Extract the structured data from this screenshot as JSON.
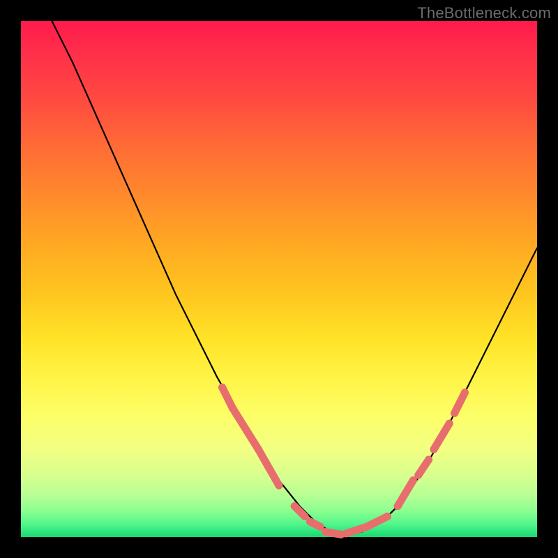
{
  "watermark": "TheBottleneck.com",
  "colors": {
    "frame": "#000000",
    "line": "#000000",
    "marker": "#e86d6d",
    "watermark": "#6b6b6b"
  },
  "chart_data": {
    "type": "line",
    "title": "",
    "xlabel": "",
    "ylabel": "",
    "xlim": [
      0,
      100
    ],
    "ylim": [
      0,
      100
    ],
    "grid": false,
    "legend": false,
    "series": [
      {
        "name": "bottleneck-curve",
        "x": [
          6,
          10,
          14,
          18,
          22,
          26,
          30,
          34,
          38,
          42,
          46,
          50,
          54,
          57,
          60,
          63,
          66,
          70,
          74,
          78,
          82,
          86,
          90,
          94,
          98,
          100
        ],
        "y": [
          100,
          92,
          83,
          74,
          65,
          56,
          47,
          39,
          31,
          24,
          17,
          11,
          6,
          3,
          1,
          0.5,
          1,
          3,
          7,
          13,
          20,
          28,
          36,
          44,
          52,
          56
        ]
      }
    ],
    "markers": [
      {
        "name": "left-cluster-1",
        "x_start": 39,
        "x_end": 41,
        "y_start": 29,
        "y_end": 25
      },
      {
        "name": "left-cluster-2",
        "x_start": 41,
        "x_end": 46,
        "y_start": 25,
        "y_end": 17
      },
      {
        "name": "left-cluster-3",
        "x_start": 46,
        "x_end": 50,
        "y_start": 17,
        "y_end": 10
      },
      {
        "name": "valley-1",
        "x_start": 53,
        "x_end": 55,
        "y_start": 6,
        "y_end": 4
      },
      {
        "name": "valley-2",
        "x_start": 56,
        "x_end": 58,
        "y_start": 3,
        "y_end": 2
      },
      {
        "name": "valley-3",
        "x_start": 59,
        "x_end": 62,
        "y_start": 1,
        "y_end": 0.5
      },
      {
        "name": "valley-4",
        "x_start": 63,
        "x_end": 67,
        "y_start": 0.7,
        "y_end": 2
      },
      {
        "name": "right-cluster-1",
        "x_start": 67,
        "x_end": 71,
        "y_start": 2,
        "y_end": 4
      },
      {
        "name": "right-cluster-2",
        "x_start": 73,
        "x_end": 76,
        "y_start": 6,
        "y_end": 11
      },
      {
        "name": "right-cluster-3",
        "x_start": 77,
        "x_end": 79,
        "y_start": 12,
        "y_end": 15
      },
      {
        "name": "right-cluster-4",
        "x_start": 80,
        "x_end": 83,
        "y_start": 17,
        "y_end": 22
      },
      {
        "name": "right-outlier",
        "x_start": 84,
        "x_end": 86,
        "y_start": 24,
        "y_end": 28
      }
    ]
  }
}
